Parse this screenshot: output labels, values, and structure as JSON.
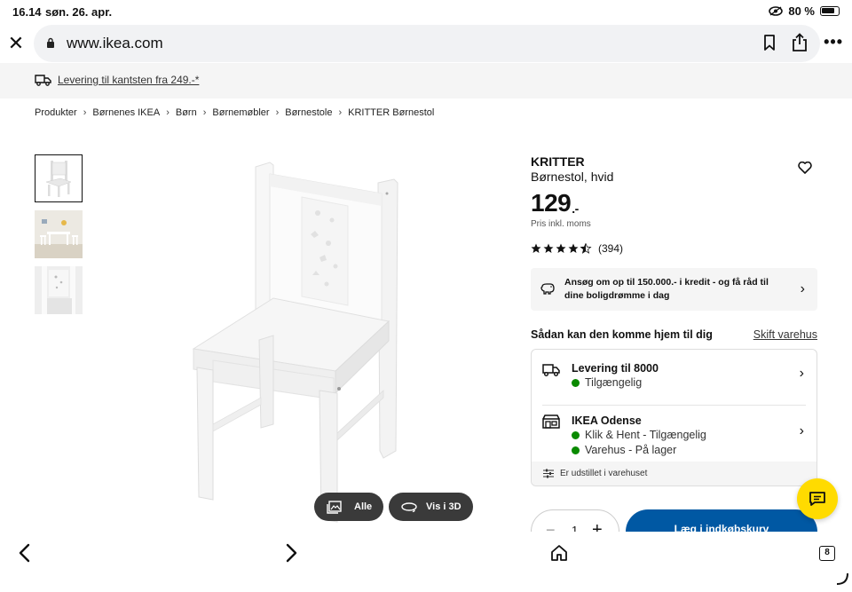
{
  "status": {
    "time": "16.14",
    "date": "søn. 26. apr.",
    "battery": "80 %"
  },
  "browser": {
    "url": "www.ikea.com",
    "tab_count": "8"
  },
  "promo": {
    "text": "Levering til kantsten fra 249.-*"
  },
  "breadcrumb": [
    "Produkter",
    "Børnenes IKEA",
    "Børn",
    "Børnemøbler",
    "Børnestole",
    "KRITTER Børnestol"
  ],
  "gallery": {
    "all_label": "Alle",
    "view3d_label": "Vis i 3D"
  },
  "product": {
    "name": "KRITTER",
    "description": "Børnestol, hvid",
    "price": "129",
    "price_suffix": ".-",
    "price_note": "Pris inkl. moms",
    "rating_stars": 4.5,
    "review_count": "(394)"
  },
  "credit": {
    "text": "Ansøg om op til 150.000.- i kredit - og få råd til dine boligdrømme i dag"
  },
  "delivery": {
    "heading": "Sådan kan den komme hjem til dig",
    "change_store": "Skift varehus",
    "home_title": "Levering til 8000",
    "home_status": "Tilgængelig",
    "store_title": "IKEA Odense",
    "store_line1": "Klik & Hent - Tilgængelig",
    "store_line2": "Varehus - På lager",
    "footer": "Er udstillet i varehuset",
    "status_color": "#0a8a00"
  },
  "cart": {
    "quantity": "1",
    "add_label": "Læg i indkøbskurv",
    "button_color": "#0058a3"
  },
  "colors": {
    "chat": "#ffdb00"
  }
}
